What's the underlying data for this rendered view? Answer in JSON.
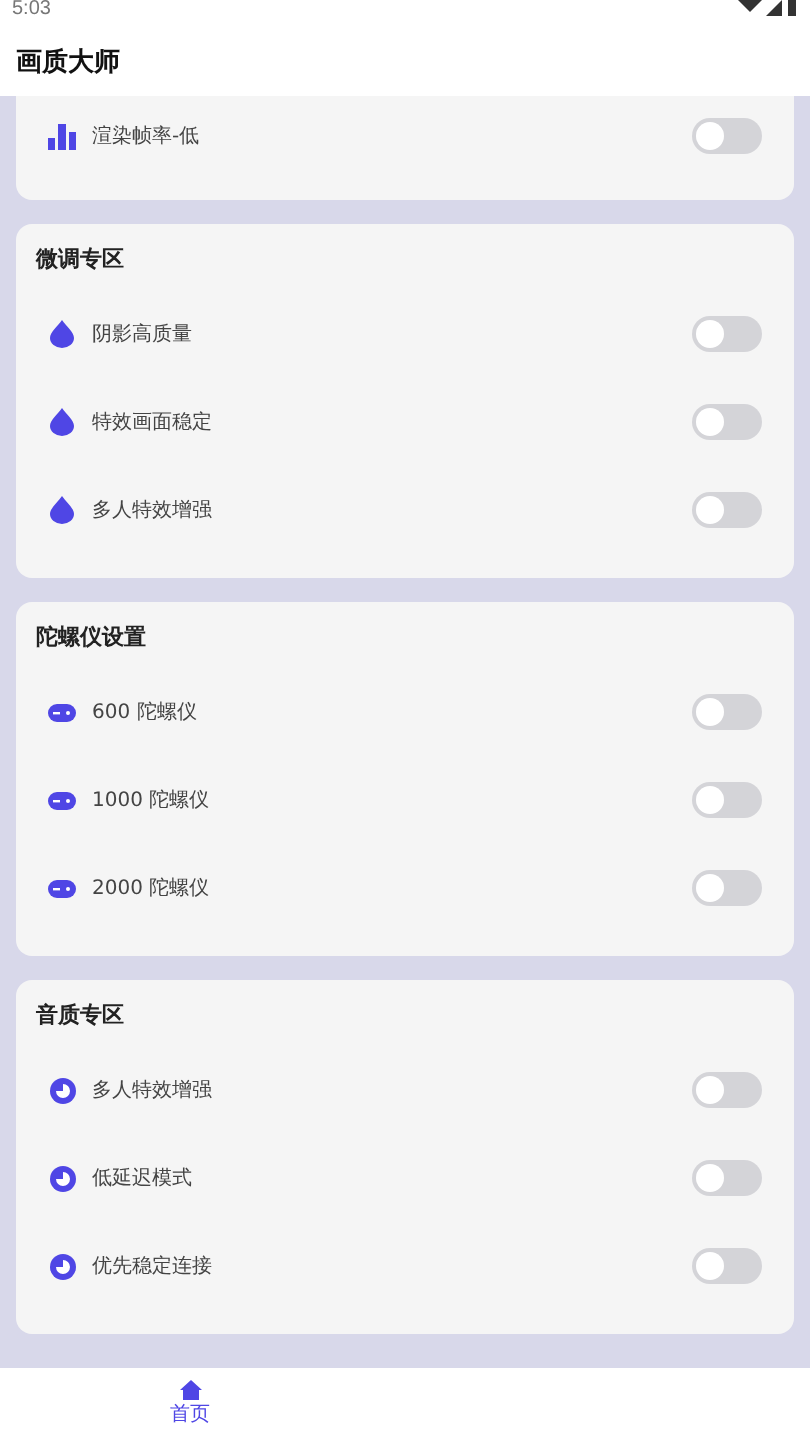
{
  "status_bar": {
    "time": "5:03"
  },
  "app_bar": {
    "title": "画质大师"
  },
  "sections": [
    {
      "items": [
        {
          "label": "渲染帧率-低",
          "on": false
        }
      ]
    },
    {
      "title": "微调专区",
      "items": [
        {
          "label": "阴影高质量",
          "on": false
        },
        {
          "label": "特效画面稳定",
          "on": false
        },
        {
          "label": "多人特效增强",
          "on": false
        }
      ]
    },
    {
      "title": "陀螺仪设置",
      "items": [
        {
          "label": "600 陀螺仪",
          "on": false
        },
        {
          "label": "1000 陀螺仪",
          "on": false
        },
        {
          "label": "2000 陀螺仪",
          "on": false
        }
      ]
    },
    {
      "title": "音质专区",
      "items": [
        {
          "label": "多人特效增强",
          "on": false
        },
        {
          "label": "低延迟模式",
          "on": false
        },
        {
          "label": "优先稳定连接",
          "on": false
        }
      ]
    }
  ],
  "bottom_nav": [
    {
      "label": "首页",
      "selected": true
    }
  ]
}
